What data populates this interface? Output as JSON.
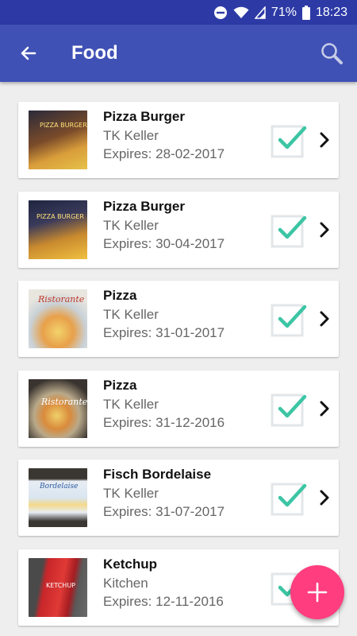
{
  "status_bar": {
    "battery": "71%",
    "time": "18:23"
  },
  "app_bar": {
    "title": "Food"
  },
  "items": [
    {
      "name": "Pizza Burger",
      "location": "TK Keller",
      "expires": "Expires: 28-02-2017",
      "checked": true
    },
    {
      "name": "Pizza Burger",
      "location": "TK Keller",
      "expires": "Expires: 30-04-2017",
      "checked": true
    },
    {
      "name": "Pizza",
      "location": "TK Keller",
      "expires": "Expires: 31-01-2017",
      "checked": true
    },
    {
      "name": "Pizza",
      "location": "TK Keller",
      "expires": "Expires: 31-12-2016",
      "checked": true
    },
    {
      "name": "Fisch Bordelaise",
      "location": "TK Keller",
      "expires": "Expires: 31-07-2017",
      "checked": true
    },
    {
      "name": "Ketchup",
      "location": "Kitchen",
      "expires": "Expires: 12-11-2016",
      "checked": true
    }
  ],
  "colors": {
    "primary": "#3f51b5",
    "primary_dark": "#2d3aa6",
    "accent": "#ff3d7f",
    "check": "#3cc5a4"
  },
  "icons": {
    "back": "arrow-back-icon",
    "search": "search-icon",
    "add": "plus-icon"
  }
}
